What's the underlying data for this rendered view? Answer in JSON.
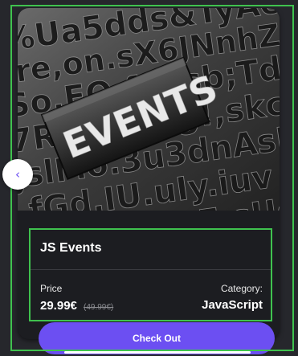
{
  "product": {
    "title": "JS Events",
    "image_alt": "EVENTS",
    "price_label": "Price",
    "price_current": "29.99€",
    "price_old": "(49.99€)",
    "category_label": "Category:",
    "category_value": "JavaScript"
  },
  "actions": {
    "checkout_label": "Check Out",
    "prev_icon": "‹"
  },
  "colors": {
    "accent": "#6c4ff2",
    "focus_outline": "#3fc24e",
    "card_bg": "#1c1d21",
    "page_bg": "#26272c"
  }
}
